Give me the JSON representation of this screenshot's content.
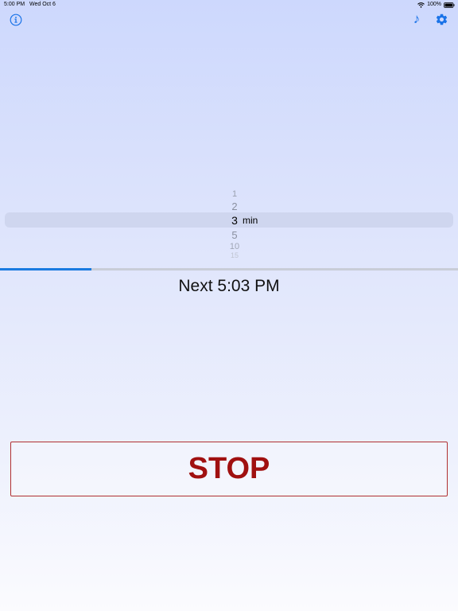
{
  "status_bar": {
    "time": "5:00 PM",
    "date": "Wed Oct 6",
    "battery": "100%"
  },
  "toolbar": {
    "info_icon": "info-icon",
    "music_icon": "music-note-icon",
    "music_glyph": "♪",
    "settings_icon": "gear-icon"
  },
  "picker": {
    "options": [
      "1",
      "2",
      "3",
      "5",
      "10",
      "15"
    ],
    "selected": "3",
    "unit": "min"
  },
  "progress": {
    "fraction": 0.2
  },
  "next": {
    "label": "Next 5:03 PM"
  },
  "stop_button": {
    "label": "STOP"
  },
  "colors": {
    "accent": "#1a7be0",
    "stop": "#a01010",
    "stop_border": "#b03030"
  }
}
